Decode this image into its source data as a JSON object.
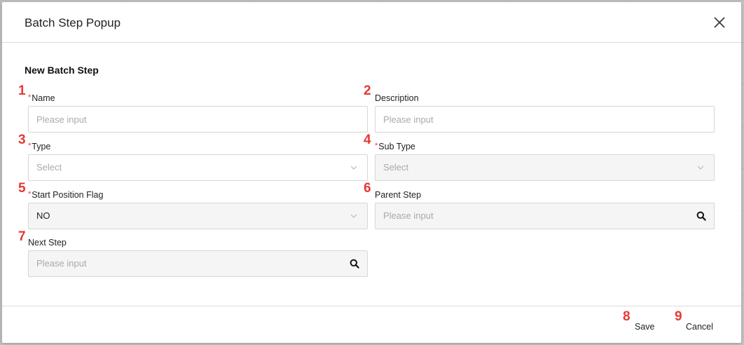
{
  "popup": {
    "title": "Batch Step Popup",
    "close_icon": "close-icon",
    "section_title": "New Batch Step"
  },
  "fields": {
    "name": {
      "marker": "1",
      "required": true,
      "label": "Name",
      "placeholder": "Please input",
      "value": ""
    },
    "description": {
      "marker": "2",
      "required": false,
      "label": "Description",
      "placeholder": "Please input",
      "value": ""
    },
    "type": {
      "marker": "3",
      "required": true,
      "label": "Type",
      "value": "Select"
    },
    "sub_type": {
      "marker": "4",
      "required": true,
      "label": "Sub Type",
      "value": "Select"
    },
    "start_position_flag": {
      "marker": "5",
      "required": true,
      "label": "Start Position Flag",
      "value": "NO"
    },
    "parent_step": {
      "marker": "6",
      "required": false,
      "label": "Parent Step",
      "placeholder": "Please input",
      "icon": "search-icon"
    },
    "next_step": {
      "marker": "7",
      "required": false,
      "label": "Next Step",
      "placeholder": "Please input",
      "icon": "search-icon"
    }
  },
  "footer": {
    "save": {
      "marker": "8",
      "label": "Save"
    },
    "cancel": {
      "marker": "9",
      "label": "Cancel"
    }
  },
  "colors": {
    "marker": "#e53935",
    "required_asterisk": "#e53935",
    "border": "#d6d6d6",
    "placeholder": "#aaaaaa"
  },
  "required_mark": "*"
}
